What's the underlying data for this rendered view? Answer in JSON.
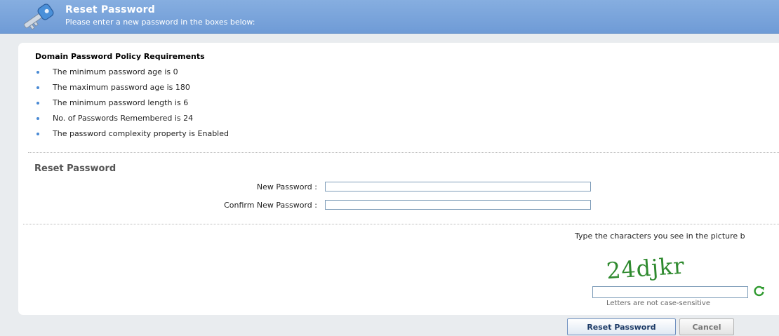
{
  "header": {
    "title": "Reset Password",
    "subtitle": "Please enter a new password in the boxes below:",
    "icon": "key-icon"
  },
  "policy": {
    "title": "Domain Password Policy Requirements",
    "items": [
      "The minimum password age is 0",
      "The maximum password age is 180",
      "The minimum password length is 6",
      "No. of Passwords Remembered is 24",
      "The password complexity property is Enabled"
    ]
  },
  "form": {
    "title": "Reset Password",
    "new_password_label": "New Password :",
    "new_password_value": "",
    "confirm_password_label": "Confirm New Password :",
    "confirm_password_value": ""
  },
  "captcha": {
    "instruction": "Type the characters you see in the picture b",
    "image_text": "24djkr",
    "input_value": "",
    "note": "Letters are not case-sensitive",
    "refresh_icon": "refresh-icon"
  },
  "buttons": {
    "reset": "Reset Password",
    "cancel": "Cancel"
  },
  "colors": {
    "banner": "#7ea6dc",
    "bullet": "#4a8ad4",
    "captcha_text": "#2f8a2f"
  }
}
